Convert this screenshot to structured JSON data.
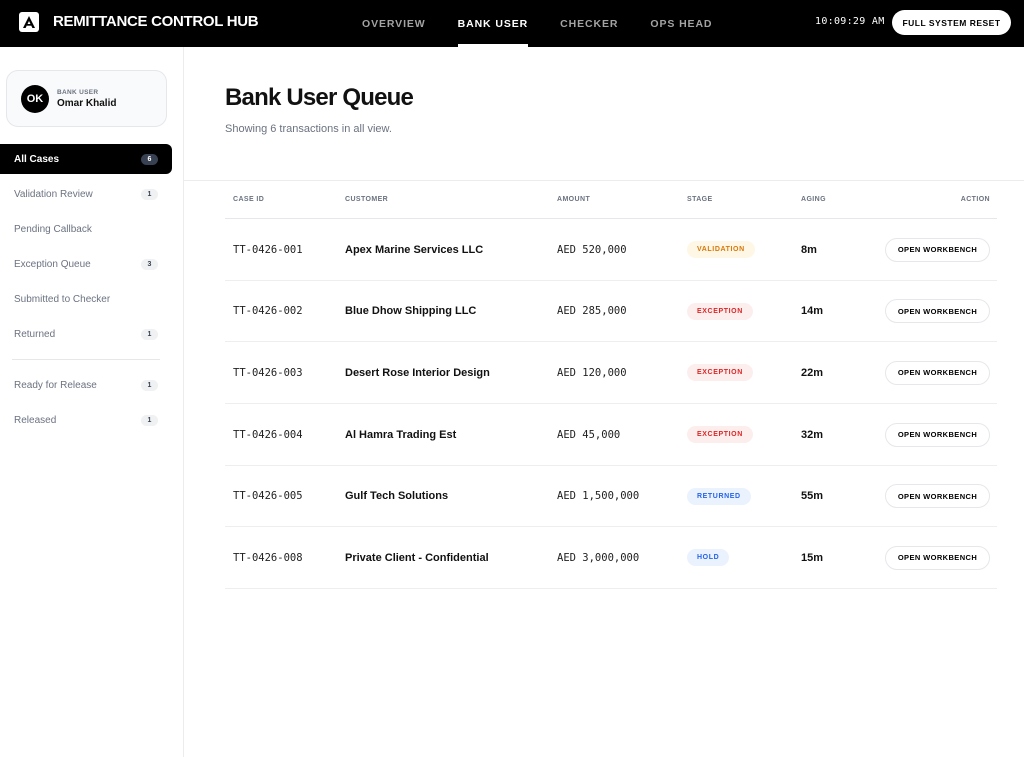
{
  "header": {
    "app_title": "REMITTANCE CONTROL HUB",
    "nav": [
      {
        "label": "OVERVIEW",
        "active": false
      },
      {
        "label": "BANK USER",
        "active": true
      },
      {
        "label": "CHECKER",
        "active": false
      },
      {
        "label": "OPS HEAD",
        "active": false
      }
    ],
    "clock": "10:09:29 AM",
    "reset_label": "FULL SYSTEM RESET"
  },
  "sidebar": {
    "user": {
      "initials": "OK",
      "role": "BANK USER",
      "name": "Omar Khalid"
    },
    "items": [
      {
        "label": "All Cases",
        "count": "6",
        "active": true
      },
      {
        "label": "Validation Review",
        "count": "1",
        "active": false
      },
      {
        "label": "Pending Callback",
        "count": "",
        "active": false
      },
      {
        "label": "Exception Queue",
        "count": "3",
        "active": false
      },
      {
        "label": "Submitted to Checker",
        "count": "",
        "active": false
      },
      {
        "label": "Returned",
        "count": "1",
        "active": false
      },
      {
        "label": "Ready for Release",
        "count": "1",
        "active": false
      },
      {
        "label": "Released",
        "count": "1",
        "active": false
      }
    ]
  },
  "main": {
    "title": "Bank User Queue",
    "subtitle": "Showing 6 transactions in all view.",
    "columns": {
      "case_id": "CASE ID",
      "customer": "CUSTOMER",
      "amount": "AMOUNT",
      "stage": "STAGE",
      "aging": "AGING",
      "action": "ACTION"
    },
    "rows": [
      {
        "case_id": "TT-0426-001",
        "customer": "Apex Marine Services LLC",
        "amount": "AED 520,000",
        "stage": "VALIDATION",
        "aging": "8m",
        "action": "OPEN WORKBENCH"
      },
      {
        "case_id": "TT-0426-002",
        "customer": "Blue Dhow Shipping LLC",
        "amount": "AED 285,000",
        "stage": "EXCEPTION",
        "aging": "14m",
        "action": "OPEN WORKBENCH"
      },
      {
        "case_id": "TT-0426-003",
        "customer": "Desert Rose Interior Design",
        "amount": "AED 120,000",
        "stage": "EXCEPTION",
        "aging": "22m",
        "action": "OPEN WORKBENCH"
      },
      {
        "case_id": "TT-0426-004",
        "customer": "Al Hamra Trading Est",
        "amount": "AED 45,000",
        "stage": "EXCEPTION",
        "aging": "32m",
        "action": "OPEN WORKBENCH"
      },
      {
        "case_id": "TT-0426-005",
        "customer": "Gulf Tech Solutions",
        "amount": "AED 1,500,000",
        "stage": "RETURNED",
        "aging": "55m",
        "action": "OPEN WORKBENCH"
      },
      {
        "case_id": "TT-0426-008",
        "customer": "Private Client - Confidential",
        "amount": "AED 3,000,000",
        "stage": "HOLD",
        "aging": "15m",
        "action": "OPEN WORKBENCH"
      }
    ]
  },
  "stage_colors": {
    "VALIDATION": {
      "bg": "#fff7e6",
      "fg": "#d97706"
    },
    "EXCEPTION": {
      "bg": "#fdeeee",
      "fg": "#dc2626"
    },
    "RETURNED": {
      "bg": "#eaf2fe",
      "fg": "#2563eb"
    },
    "HOLD": {
      "bg": "#eaf2fe",
      "fg": "#2563eb"
    }
  }
}
